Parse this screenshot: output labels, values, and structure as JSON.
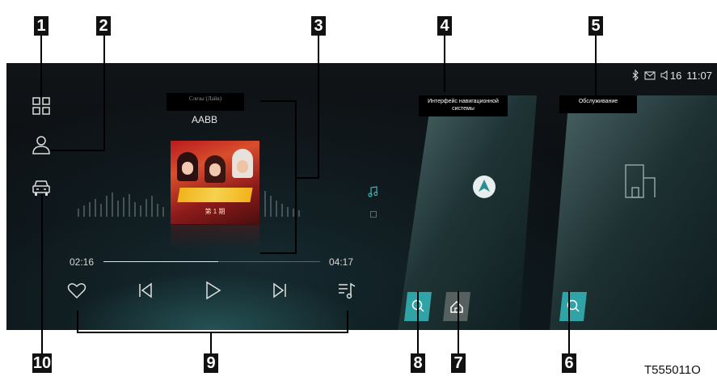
{
  "callouts": [
    "1",
    "2",
    "3",
    "4",
    "5",
    "6",
    "7",
    "8",
    "9",
    "10"
  ],
  "figure_code": "T555011O",
  "status_bar": {
    "icons": [
      "bluetooth-icon",
      "mail-icon",
      "volume-icon"
    ],
    "volume": "16",
    "time": "11:07"
  },
  "sidebar": {
    "icons": [
      "apps-grid-icon",
      "user-icon",
      "car-icon"
    ]
  },
  "player": {
    "song_title": "Слезы (Лайв)",
    "artist": "AABB",
    "album_episode": "第 1 期",
    "current_time": "02:16",
    "total_time": "04:17",
    "progress": 0.53,
    "controls": [
      "favorite-heart-icon",
      "previous-track-icon",
      "play-icon",
      "next-track-icon",
      "playlist-icon"
    ],
    "side_icons": [
      "music-note-icon",
      "square-icon"
    ]
  },
  "cards": {
    "navigation": {
      "label": "Интерфейс навигационной системы",
      "buttons": [
        "search-icon",
        "home-icon"
      ]
    },
    "service": {
      "label": "Обслуживание",
      "buttons": [
        "search-icon"
      ]
    }
  },
  "colors": {
    "screen_bg": "#0b0f12",
    "accent_teal": "#2fa3a5",
    "button_gray": "#56605f",
    "text": "#e6e6e6"
  }
}
